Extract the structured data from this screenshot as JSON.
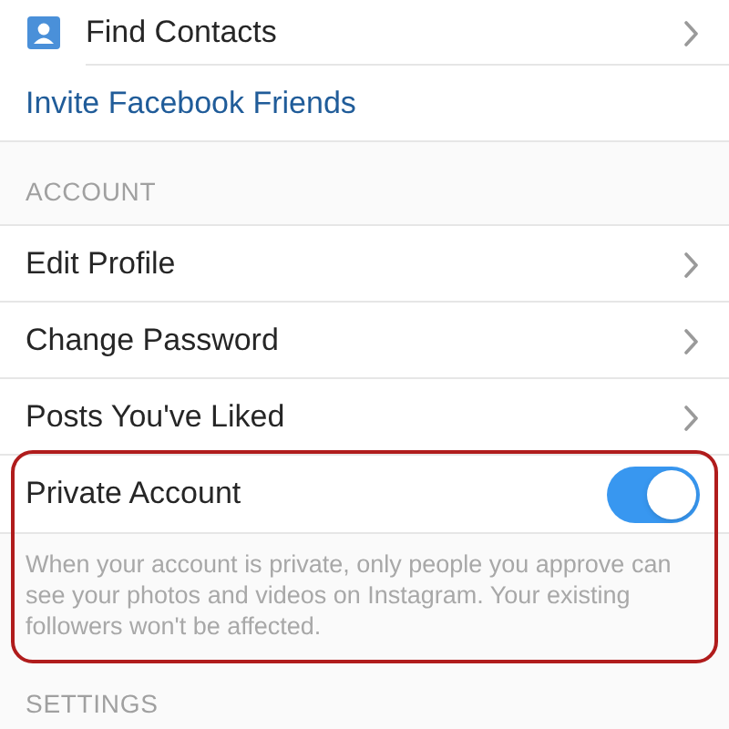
{
  "rows": [
    {
      "kind": "icon_nav",
      "label": "Find Contacts"
    },
    {
      "kind": "link",
      "label": "Invite Facebook Friends"
    },
    {
      "kind": "header",
      "label": "ACCOUNT"
    },
    {
      "kind": "nav",
      "label": "Edit Profile"
    },
    {
      "kind": "nav",
      "label": "Change Password"
    },
    {
      "kind": "nav",
      "label": "Posts You've Liked"
    },
    {
      "kind": "toggle",
      "label": "Private Account",
      "on": true,
      "highlighted": true,
      "note": "When your account is private, only people you approve can see your photos and videos on Instagram. Your existing followers won't be affected."
    },
    {
      "kind": "header",
      "label": "SETTINGS"
    }
  ]
}
